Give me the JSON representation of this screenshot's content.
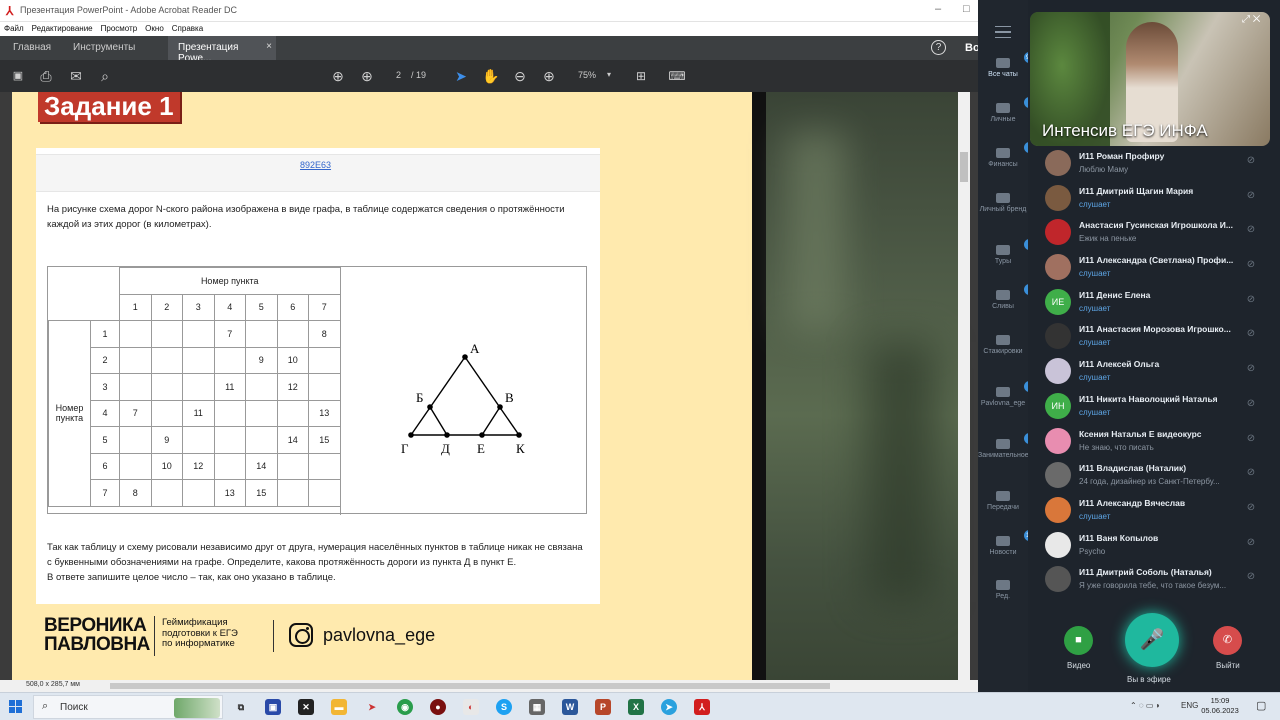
{
  "acrobat": {
    "window_title": "Презентация PowerPoint - Adobe Acrobat Reader DC",
    "menu": [
      "Файл",
      "Редактирование",
      "Просмотр",
      "Окно",
      "Справка"
    ],
    "tabs": {
      "home": "Главная",
      "tools": "Инструменты",
      "doc": "Презентация Powe...",
      "close": "×"
    },
    "help": "?",
    "user_initials": "Во",
    "toolbar": {
      "page_current": "2",
      "page_total": "/ 19",
      "zoom": "75%",
      "zoom_caret": "▾"
    },
    "statusbar": {
      "dimensions": "508,0 x 285,7 мм"
    }
  },
  "slide": {
    "task_title": "Задание 1",
    "code": "892E63",
    "intro": "На рисунке схема дорог N-ского района изображена в виде графа, в таблице содержатся сведения о протяжённости каждой из этих дорог (в километрах).",
    "table": {
      "col_header": "Номер пункта",
      "row_header": "Номер пункта",
      "cols": [
        "1",
        "2",
        "3",
        "4",
        "5",
        "6",
        "7"
      ],
      "rows": [
        {
          "n": "1",
          "cells": [
            "",
            "",
            "",
            "7",
            "",
            "",
            "8"
          ]
        },
        {
          "n": "2",
          "cells": [
            "",
            "",
            "",
            "",
            "9",
            "10",
            ""
          ]
        },
        {
          "n": "3",
          "cells": [
            "",
            "",
            "",
            "11",
            "",
            "12",
            ""
          ]
        },
        {
          "n": "4",
          "cells": [
            "7",
            "",
            "11",
            "",
            "",
            "",
            "13"
          ]
        },
        {
          "n": "5",
          "cells": [
            "",
            "9",
            "",
            "",
            "",
            "14",
            "15"
          ]
        },
        {
          "n": "6",
          "cells": [
            "",
            "10",
            "12",
            "",
            "14",
            "",
            ""
          ]
        },
        {
          "n": "7",
          "cells": [
            "8",
            "",
            "",
            "13",
            "15",
            "",
            ""
          ]
        }
      ]
    },
    "graph_labels": {
      "A": "А",
      "B": "Б",
      "V": "В",
      "G": "Г",
      "D": "Д",
      "E": "Е",
      "K": "К"
    },
    "question": "Так как таблицу и схему рисовали независимо друг от друга, нумерация населённых пунктов в таблице никак не связана с буквенными обозначениями на графе. Определите, какова протяжённость дороги из пункта Д в пункт Е.",
    "answer_hint": "В ответе запишите целое число – так, как оно указано в таблице.",
    "brand_name_1": "ВЕРОНИКА",
    "brand_name_2": "ПАВЛОВНА",
    "brand_sub_1": "Геймификация",
    "brand_sub_2": "подготовки к ЕГЭ",
    "brand_sub_3": "по информатике",
    "instagram": "pavlovna_ege"
  },
  "telegram": {
    "nav": [
      {
        "label": "Все чаты",
        "badge": "99+"
      },
      {
        "label": "Личные",
        "badge": "1"
      },
      {
        "label": "Финансы",
        "badge": "3"
      },
      {
        "label": "Личный бренд",
        "badge": ""
      },
      {
        "label": "Туры",
        "badge": "1"
      },
      {
        "label": "Сливы",
        "badge": "5"
      },
      {
        "label": "Стажировки",
        "badge": ""
      },
      {
        "label": "Pavlovna_ege",
        "badge": "1"
      },
      {
        "label": "Занимательное",
        "badge": "9"
      },
      {
        "label": "Передачи",
        "badge": ""
      },
      {
        "label": "Новости",
        "badge": "14"
      },
      {
        "label": "Ред.",
        "badge": ""
      }
    ],
    "call_title": "Интенсив ЕГЭ ИНФА",
    "participants": [
      {
        "name": "И11 Роман Профиру",
        "status": "Люблю Маму",
        "initials": "",
        "color": "#8a6a5a",
        "status_kind": "gray"
      },
      {
        "name": "И11 Дмитрий Щагин Мария",
        "status": "слушает",
        "initials": "",
        "color": "#7a5a40",
        "status_kind": "blue"
      },
      {
        "name": "Анастасия Гусинская Игрошкола И...",
        "status": "Ежик на пеньке",
        "initials": "",
        "color": "#c0262b",
        "status_kind": "gray"
      },
      {
        "name": "И11 Александра (Светлана) Профи...",
        "status": "слушает",
        "initials": "",
        "color": "#a07060",
        "status_kind": "blue"
      },
      {
        "name": "И11 Денис Елена",
        "status": "слушает",
        "initials": "ИЕ",
        "color": "#3fae49",
        "status_kind": "blue"
      },
      {
        "name": "И11 Анастасия Морозова Игрошко...",
        "status": "слушает",
        "initials": "",
        "color": "#333333",
        "status_kind": "blue"
      },
      {
        "name": "И11 Алексей Ольга",
        "status": "слушает",
        "initials": "",
        "color": "#c9c3d8",
        "status_kind": "blue"
      },
      {
        "name": "И11 Никита Наволоцкий Наталья",
        "status": "слушает",
        "initials": "ИН",
        "color": "#3fae49",
        "status_kind": "blue"
      },
      {
        "name": "Ксения Наталья Е видеокурс",
        "status": "Не знаю, что писать",
        "initials": "",
        "color": "#e88db0",
        "status_kind": "gray"
      },
      {
        "name": "И11 Владислав (Наталик)",
        "status": "24 года, дизайнер из Санкт-Петербу...",
        "initials": "",
        "color": "#6a6a6a",
        "status_kind": "gray"
      },
      {
        "name": "И11 Александр Вячеслав",
        "status": "слушает",
        "initials": "",
        "color": "#d9773a",
        "status_kind": "blue"
      },
      {
        "name": "И11 Ваня Копылов",
        "status": "Psycho",
        "initials": "",
        "color": "#e8e8e8",
        "status_kind": "gray"
      },
      {
        "name": "И11 Дмитрий Соболь (Наталья)",
        "status": "Я уже говорила тебе, что такое безум...",
        "initials": "",
        "color": "#555555",
        "status_kind": "gray"
      }
    ],
    "controls": {
      "video": "Видео",
      "mic": "Вы в эфире",
      "leave": "Выйти"
    }
  },
  "taskbar": {
    "search": "Поиск",
    "lang": "ENG",
    "time": "15:09",
    "date": "05.06.2023"
  }
}
